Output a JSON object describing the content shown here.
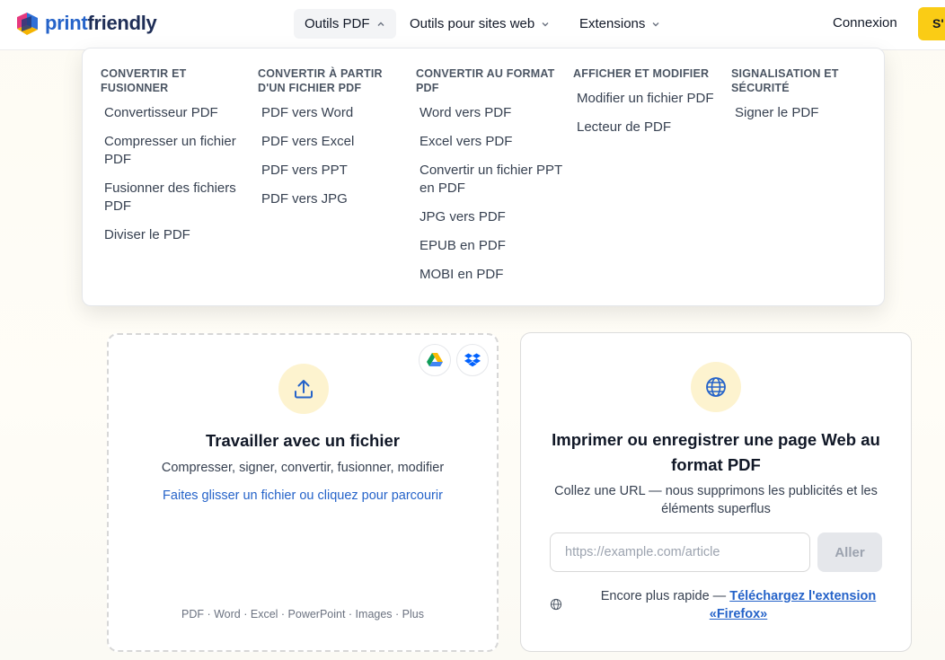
{
  "header": {
    "logo_print": "print",
    "logo_friendly": "friendly",
    "nav": [
      {
        "label": "Outils PDF"
      },
      {
        "label": "Outils pour sites web"
      },
      {
        "label": "Extensions"
      }
    ],
    "login": "Connexion",
    "cta": "S'"
  },
  "dropdown": {
    "columns": [
      {
        "heading": "CONVERTIR ET FUSIONNER",
        "links": [
          "Convertisseur PDF",
          "Compresser un fichier PDF",
          "Fusionner des fichiers PDF",
          "Diviser le PDF"
        ]
      },
      {
        "heading": "CONVERTIR À PARTIR D'UN FICHIER PDF",
        "links": [
          "PDF vers Word",
          "PDF vers Excel",
          "PDF vers PPT",
          "PDF vers JPG"
        ]
      },
      {
        "heading": "CONVERTIR AU FORMAT PDF",
        "links": [
          "Word vers PDF",
          "Excel vers PDF",
          "Convertir un fichier PPT en PDF",
          "JPG vers PDF",
          "EPUB en PDF",
          "MOBI en PDF"
        ]
      },
      {
        "heading": "AFFICHER ET MODIFIER",
        "links": [
          "Modifier un fichier PDF",
          "Lecteur de PDF"
        ]
      },
      {
        "heading": "SIGNALISATION ET SÉCURITÉ",
        "links": [
          "Signer le PDF"
        ]
      }
    ]
  },
  "upload_card": {
    "title": "Travailler avec un fichier",
    "subtitle": "Compresser, signer, convertir, fusionner, modifier",
    "link": "Faites glisser un fichier ou cliquez pour parcourir",
    "formats": "PDF · Word · Excel · PowerPoint · Images · Plus"
  },
  "web_card": {
    "title": "Imprimer ou enregistrer une page Web au format PDF",
    "subtitle": "Collez une URL — nous supprimons les publicités et les éléments superflus",
    "url_placeholder": "https://example.com/article",
    "go_label": "Aller",
    "ext_prefix": "Encore plus rapide — ",
    "ext_link": "Téléchargez l'extension «Firefox»"
  },
  "colors": {
    "accent_blue": "#2563c9",
    "cta_yellow": "#facc15",
    "icon_bg": "#fdf3cf"
  }
}
